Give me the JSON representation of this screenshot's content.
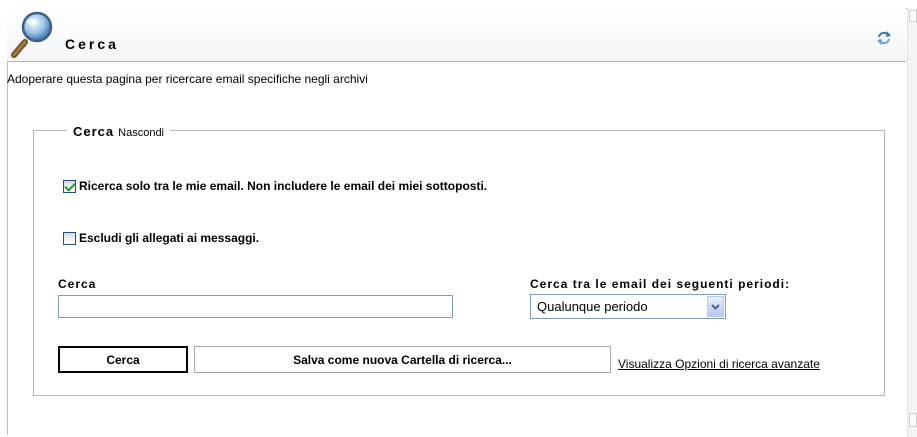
{
  "header": {
    "title": "Cerca",
    "icon": "magnifier-icon",
    "refresh_icon": "refresh-icon"
  },
  "intro_text": "Adoperare questa pagina per ricercare email specifiche negli archivi",
  "search_panel": {
    "legend_title": "Cerca",
    "legend_toggle": "Nascondi",
    "only_my_email": {
      "label": "Ricerca solo tra le mie email. Non includere le email dei miei sottoposti.",
      "checked": true
    },
    "exclude_attachments": {
      "label": "Escludi gli allegati ai messaggi.",
      "checked": false
    },
    "query_label": "Cerca",
    "query_value": "",
    "period_label": "Cerca tra le email dei seguenti periodi:",
    "period_selected": "Qualunque periodo",
    "search_button": "Cerca",
    "save_button": "Salva come nuova Cartella di ricerca...",
    "advanced_link": "Visualizza Opzioni di ricerca avanzate"
  },
  "colors": {
    "checkbox_border": "#1c5180",
    "checkmark": "#21a121",
    "input_border": "#7f9db9",
    "fieldset_border": "#b5b5b5"
  }
}
